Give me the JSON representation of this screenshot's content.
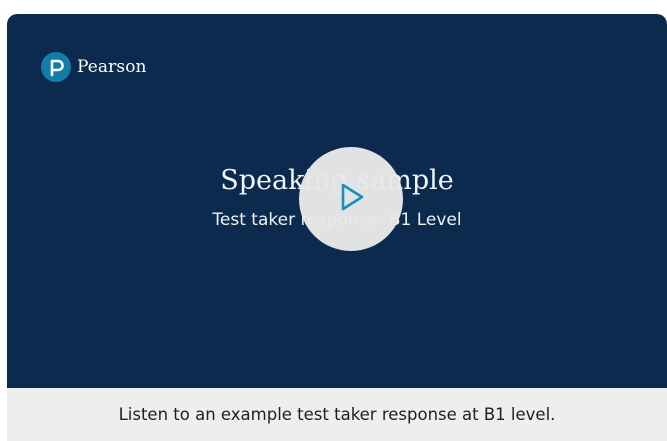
{
  "brand": {
    "name": "Pearson",
    "icon": "pearson-p-logo-icon",
    "color": "#127ea7"
  },
  "video": {
    "title": "Speaking sample",
    "subtitle": "Test taker response: B1 Level",
    "background": "#0b2a4d",
    "play_icon": "play-icon",
    "play_icon_color": "#1c8fb6"
  },
  "caption": "Listen to an example test taker response at B1 level."
}
